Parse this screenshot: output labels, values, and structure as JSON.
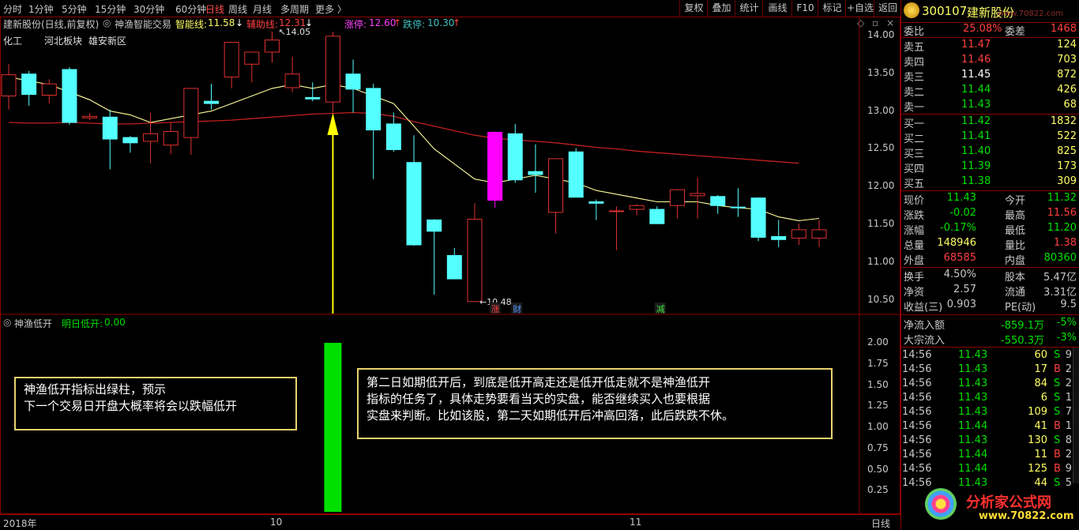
{
  "toolbar": {
    "periods": [
      "分时",
      "1分钟",
      "5分钟",
      "15分钟",
      "30分钟",
      "60分钟",
      "日线",
      "周线",
      "月线",
      "多周期",
      "更多 〉"
    ],
    "active_period": "日线",
    "right_buttons": [
      "复权",
      "叠加",
      "统计",
      "画线",
      "F10",
      "标记",
      "+自选",
      "返回"
    ]
  },
  "chart_header": {
    "stock_title": "建新股份(日线,前复权)",
    "indicator_name": "神渔智能交易",
    "smart_line_label": "智能线:",
    "smart_line_value": "11.58",
    "smart_line_arrow": "↓",
    "assist_line_label": "辅助线:",
    "assist_line_value": "12.31",
    "assist_line_arrow": "↓",
    "limit_up_label": "涨停:",
    "limit_up_value": "12.60",
    "limit_up_arrow": "↑",
    "limit_down_label": "跌停:",
    "limit_down_value": "10.30",
    "limit_down_arrow": "↑"
  },
  "sector_tags": [
    "化工",
    "河北板块",
    "雄安新区"
  ],
  "high_label": "14.05",
  "low_label": "10.48",
  "event_tags": [
    "涨",
    "财",
    "减"
  ],
  "price_axis": [
    "14.00",
    "13.50",
    "13.00",
    "12.50",
    "12.00",
    "11.50",
    "11.00",
    "10.50"
  ],
  "indicator_panel": {
    "name": "神渔低开",
    "value_label": "明日低开:",
    "value": "0.00",
    "axis": [
      "2.00",
      "1.75",
      "1.50",
      "1.25",
      "1.00",
      "0.75",
      "0.50",
      "0.25"
    ]
  },
  "date_axis": [
    "2018年",
    "10",
    "11"
  ],
  "date_axis_period": "日线",
  "notes": {
    "left": [
      "神渔低开指标出绿柱，预示",
      "下一个交易日开盘大概率将会以跌幅低开"
    ],
    "right": [
      "第二日如期低开后，到底是低开高走还是低开低走就不是神渔低开",
      "指标的任务了，具体走势要看当天的实盘，能否继续买入也要根据",
      "实盘来判断。比如该股，第二天如期低开后冲高回落，此后跌跌不休。"
    ]
  },
  "quote": {
    "code": "300107",
    "name": "建新股份",
    "watermark": "www.70822.com",
    "weibi_label": "委比",
    "weibi": "25.08%",
    "weicha_label": "委差",
    "weicha": "1468",
    "asks": [
      {
        "label": "卖五",
        "price": "11.47",
        "vol": "124"
      },
      {
        "label": "卖四",
        "price": "11.46",
        "vol": "703"
      },
      {
        "label": "卖三",
        "price": "11.45",
        "vol": "872"
      },
      {
        "label": "卖二",
        "price": "11.44",
        "vol": "426"
      },
      {
        "label": "卖一",
        "price": "11.43",
        "vol": "68"
      }
    ],
    "bids": [
      {
        "label": "买一",
        "price": "11.42",
        "vol": "1832"
      },
      {
        "label": "买二",
        "price": "11.41",
        "vol": "522"
      },
      {
        "label": "买三",
        "price": "11.40",
        "vol": "825"
      },
      {
        "label": "买四",
        "price": "11.39",
        "vol": "173"
      },
      {
        "label": "买五",
        "price": "11.38",
        "vol": "309"
      }
    ],
    "stats": [
      {
        "l1": "现价",
        "v1": "11.43",
        "c1": "#00e000",
        "l2": "今开",
        "v2": "11.32",
        "c2": "#00e000"
      },
      {
        "l1": "涨跌",
        "v1": "-0.02",
        "c1": "#00e000",
        "l2": "最高",
        "v2": "11.56",
        "c2": "#ff4040"
      },
      {
        "l1": "涨幅",
        "v1": "-0.17%",
        "c1": "#00e000",
        "l2": "最低",
        "v2": "11.20",
        "c2": "#00e000"
      },
      {
        "l1": "总量",
        "v1": "148946",
        "c1": "#ffff66",
        "l2": "量比",
        "v2": "1.38",
        "c2": "#ff4040"
      },
      {
        "l1": "外盘",
        "v1": "68585",
        "c1": "#ff4040",
        "l2": "内盘",
        "v2": "80360",
        "c2": "#00e000"
      }
    ],
    "stats2": [
      {
        "l1": "换手",
        "v1": "4.50%",
        "l2": "股本",
        "v2": "5.47亿"
      },
      {
        "l1": "净资",
        "v1": "2.57",
        "l2": "流通",
        "v2": "3.31亿"
      },
      {
        "l1": "收益(三)",
        "v1": "0.903",
        "l2": "PE(动)",
        "v2": "9.5"
      }
    ],
    "flows": [
      {
        "label": "净流入额",
        "value": "-859.1万",
        "pct": "-5%"
      },
      {
        "label": "大宗流入",
        "value": "-550.3万",
        "pct": "-3%"
      }
    ],
    "ticks": [
      {
        "time": "14:56",
        "price": "11.43",
        "vol": "60",
        "side": "S",
        "n": "9"
      },
      {
        "time": "14:56",
        "price": "11.43",
        "vol": "17",
        "side": "B",
        "n": "2"
      },
      {
        "time": "14:56",
        "price": "11.43",
        "vol": "84",
        "side": "S",
        "n": "2"
      },
      {
        "time": "14:56",
        "price": "11.43",
        "vol": "6",
        "side": "S",
        "n": "1"
      },
      {
        "time": "14:56",
        "price": "11.43",
        "vol": "109",
        "side": "S",
        "n": "7"
      },
      {
        "time": "14:56",
        "price": "11.44",
        "vol": "41",
        "side": "B",
        "n": "1"
      },
      {
        "time": "14:56",
        "price": "11.43",
        "vol": "130",
        "side": "S",
        "n": "8"
      },
      {
        "time": "14:56",
        "price": "11.44",
        "vol": "11",
        "side": "B",
        "n": "2"
      },
      {
        "time": "14:56",
        "price": "11.44",
        "vol": "125",
        "side": "B",
        "n": "9"
      },
      {
        "time": "14:56",
        "price": "11.43",
        "vol": "44",
        "side": "S",
        "n": "5"
      }
    ],
    "logo_text": "分析家公式网",
    "logo_url": "www.70822.com"
  },
  "chart_data": {
    "type": "candlestick",
    "candles": [
      {
        "o": 13.2,
        "h": 13.62,
        "l": 13.02,
        "c": 13.48
      },
      {
        "o": 13.49,
        "h": 13.53,
        "l": 13.07,
        "c": 13.22
      },
      {
        "o": 13.21,
        "h": 13.42,
        "l": 13.1,
        "c": 13.36
      },
      {
        "o": 13.55,
        "h": 13.58,
        "l": 12.82,
        "c": 12.85
      },
      {
        "o": 12.91,
        "h": 12.97,
        "l": 12.88,
        "c": 12.93
      },
      {
        "o": 12.92,
        "h": 13.02,
        "l": 12.23,
        "c": 12.63
      },
      {
        "o": 12.65,
        "h": 12.67,
        "l": 12.45,
        "c": 12.58
      },
      {
        "o": 12.6,
        "h": 12.98,
        "l": 12.31,
        "c": 12.7
      },
      {
        "o": 12.55,
        "h": 12.85,
        "l": 12.43,
        "c": 12.73
      },
      {
        "o": 12.65,
        "h": 13.02,
        "l": 12.42,
        "c": 13.3
      },
      {
        "o": 13.13,
        "h": 13.36,
        "l": 13.02,
        "c": 13.1
      },
      {
        "o": 13.45,
        "h": 13.88,
        "l": 13.3,
        "c": 13.91
      },
      {
        "o": 13.62,
        "h": 13.75,
        "l": 13.38,
        "c": 13.78
      },
      {
        "o": 13.78,
        "h": 14.05,
        "l": 13.64,
        "c": 13.94
      },
      {
        "o": 13.31,
        "h": 13.72,
        "l": 13.25,
        "c": 13.49
      },
      {
        "o": 13.18,
        "h": 13.38,
        "l": 13.13,
        "c": 13.16
      },
      {
        "o": 13.12,
        "h": 14.05,
        "l": 12.98,
        "c": 13.99
      },
      {
        "o": 13.49,
        "h": 13.68,
        "l": 12.98,
        "c": 13.29
      },
      {
        "o": 13.3,
        "h": 13.36,
        "l": 12.1,
        "c": 12.75
      },
      {
        "o": 12.83,
        "h": 12.98,
        "l": 12.46,
        "c": 12.49
      },
      {
        "o": 12.32,
        "h": 12.68,
        "l": 11.22,
        "c": 11.23
      },
      {
        "o": 11.56,
        "h": 11.57,
        "l": 10.57,
        "c": 11.41
      },
      {
        "o": 11.09,
        "h": 11.19,
        "l": 10.83,
        "c": 10.78
      },
      {
        "o": 10.48,
        "h": 11.78,
        "l": 10.48,
        "c": 11.57
      },
      {
        "o": 11.82,
        "h": 12.73,
        "l": 11.72,
        "c": 12.72
      },
      {
        "o": 12.7,
        "h": 12.83,
        "l": 12.05,
        "c": 12.09
      },
      {
        "o": 12.2,
        "h": 12.56,
        "l": 11.92,
        "c": 12.16
      },
      {
        "o": 11.66,
        "h": 12.32,
        "l": 11.38,
        "c": 12.37
      },
      {
        "o": 12.46,
        "h": 12.51,
        "l": 11.86,
        "c": 11.86
      },
      {
        "o": 11.8,
        "h": 11.83,
        "l": 11.56,
        "c": 11.78
      },
      {
        "o": 11.68,
        "h": 11.74,
        "l": 11.16,
        "c": 11.68
      },
      {
        "o": 11.7,
        "h": 11.77,
        "l": 11.62,
        "c": 11.75
      },
      {
        "o": 11.7,
        "h": 11.74,
        "l": 11.53,
        "c": 11.51
      },
      {
        "o": 11.75,
        "h": 11.97,
        "l": 11.58,
        "c": 11.96
      },
      {
        "o": 11.88,
        "h": 12.12,
        "l": 11.58,
        "c": 11.91
      },
      {
        "o": 11.87,
        "h": 11.89,
        "l": 11.64,
        "c": 11.75
      },
      {
        "o": 11.73,
        "h": 11.98,
        "l": 11.6,
        "c": 11.72
      },
      {
        "o": 11.85,
        "h": 11.86,
        "l": 11.28,
        "c": 11.33
      },
      {
        "o": 11.34,
        "h": 11.56,
        "l": 11.2,
        "c": 11.3
      },
      {
        "o": 11.32,
        "h": 11.51,
        "l": 11.23,
        "c": 11.43
      },
      {
        "o": 11.32,
        "h": 11.56,
        "l": 11.2,
        "c": 11.43
      }
    ],
    "ma_short": [
      13.45,
      13.4,
      13.35,
      13.25,
      13.15,
      13.0,
      12.95,
      12.85,
      12.9,
      12.95,
      13.0,
      13.1,
      13.2,
      13.3,
      13.35,
      13.3,
      13.35,
      13.3,
      13.2,
      13.1,
      12.8,
      12.5,
      12.3,
      12.1,
      12.05,
      12.1,
      12.15,
      12.1,
      12.05,
      11.95,
      11.9,
      11.85,
      11.8,
      11.8,
      11.8,
      11.75,
      11.72,
      11.7,
      11.6,
      11.55,
      11.58
    ],
    "ma_long": [
      12.85,
      12.84,
      12.84,
      12.85,
      12.84,
      12.83,
      12.83,
      12.84,
      12.85,
      12.86,
      12.87,
      12.88,
      12.9,
      12.92,
      12.94,
      12.96,
      12.97,
      12.98,
      12.97,
      12.93,
      12.86,
      12.8,
      12.74,
      12.68,
      12.64,
      12.62,
      12.6,
      12.58,
      12.55,
      12.52,
      12.5,
      12.47,
      12.45,
      12.43,
      12.41,
      12.39,
      12.37,
      12.35,
      12.33,
      12.31
    ],
    "ylim": [
      10.3,
      14.25
    ],
    "indicator": {
      "name": "神渔低开",
      "bar_index": 16,
      "value": 2.0,
      "ylim": [
        0,
        2.15
      ]
    },
    "markers": [
      {
        "index": 16,
        "type": "arrow-up"
      }
    ]
  }
}
